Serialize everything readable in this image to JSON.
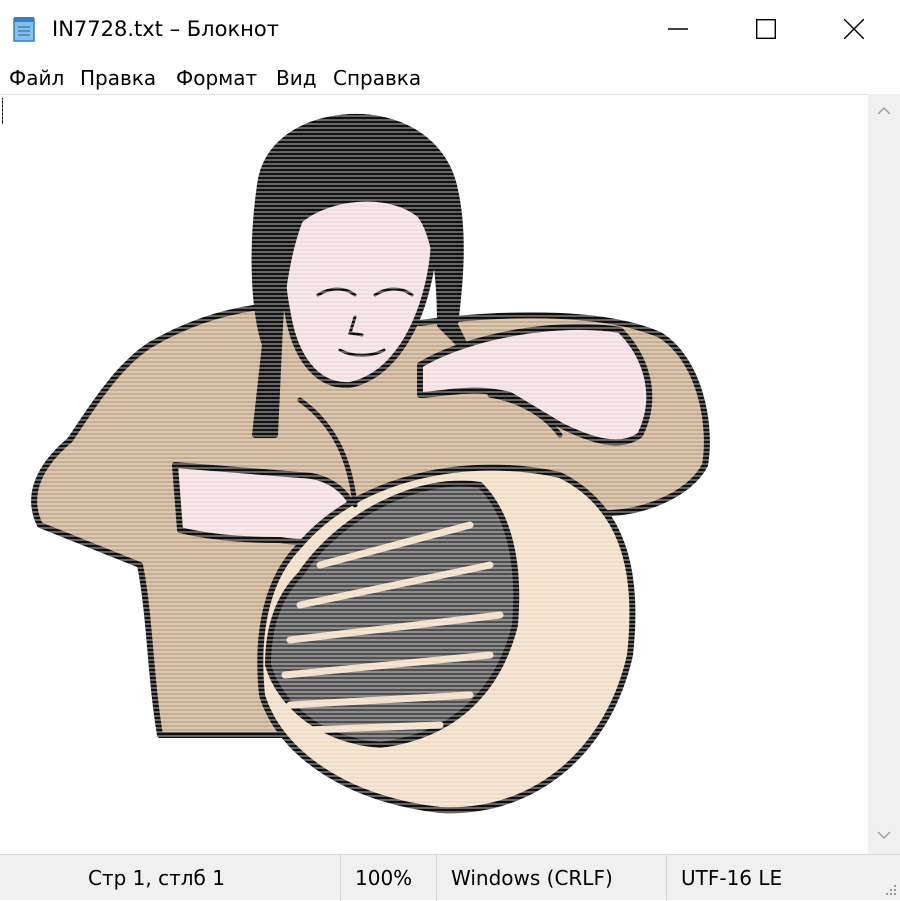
{
  "window": {
    "title": "IN7728.txt – Блокнот",
    "icon": "notepad-icon",
    "controls": [
      "minimize-icon",
      "maximize-icon",
      "close-icon"
    ]
  },
  "menu": {
    "items": [
      "Файл",
      "Правка",
      "Формат",
      "Вид",
      "Справка"
    ]
  },
  "editor": {
    "content_icon": "woman-weaving-basket-ascii-art"
  },
  "statusbar": {
    "position": "Стр 1, стлб 1",
    "zoom": "100%",
    "line_endings": "Windows (CRLF)",
    "encoding": "UTF-16 LE"
  },
  "colors": {
    "skin": "#f2dde0",
    "shirt": "#c8ac8e",
    "basket": "#f0dbc3",
    "basket_dark": "#505050",
    "hair": "#111111"
  }
}
